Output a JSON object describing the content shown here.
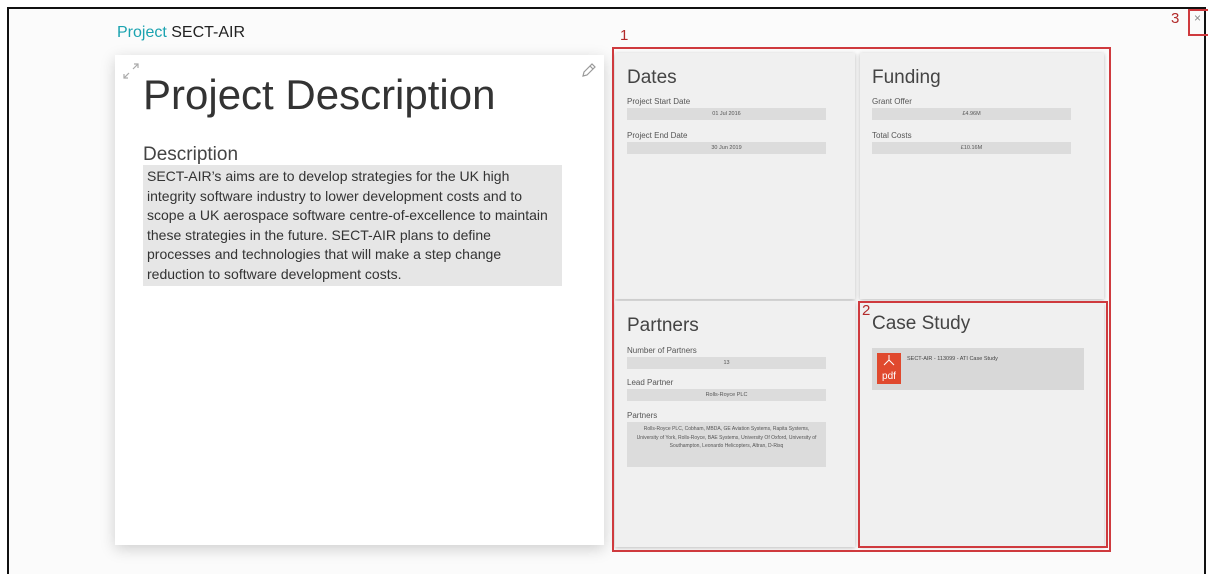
{
  "header": {
    "prefix": "Project",
    "name": "SECT-AIR"
  },
  "description_card": {
    "heading": "Project Description",
    "label": "Description",
    "text": "SECT-AIR’s aims are to develop strategies for the UK high integrity software industry to lower development costs and to scope a UK aerospace software centre-of-excellence to maintain these strategies in the future. SECT-AIR plans to define processes and technologies that will make a step change reduction to software development costs."
  },
  "dates": {
    "title": "Dates",
    "start_label": "Project Start Date",
    "start_value": "01 Jul 2016",
    "end_label": "Project End Date",
    "end_value": "30 Jun 2019"
  },
  "funding": {
    "title": "Funding",
    "grant_label": "Grant Offer",
    "grant_value": "£4.96M",
    "costs_label": "Total Costs",
    "costs_value": "£10.16M"
  },
  "partners": {
    "title": "Partners",
    "count_label": "Number of Partners",
    "count_value": "13",
    "lead_label": "Lead Partner",
    "lead_value": "Rolls-Royce PLC",
    "list_label": "Partners",
    "list_value": "Rolls-Royce PLC, Cobham, MBDA, GE Aviation Systems, Rapita Systems, University of York, Rolls-Royce, BAE Systems, University Of Oxford, University of Southampton, Leonardo Helicopters, Altran, D-Risq"
  },
  "case_study": {
    "title": "Case Study",
    "document": "SECT-AIR - 113099 - ATI Case Study",
    "icon_text": "pdf"
  },
  "close": {
    "symbol": "×"
  },
  "markers": {
    "one": "1",
    "two": "2",
    "three": "3"
  },
  "colors": {
    "accent": "#1ba3b0",
    "annotation": "#cf3a3e",
    "pdf": "#e0492e"
  }
}
